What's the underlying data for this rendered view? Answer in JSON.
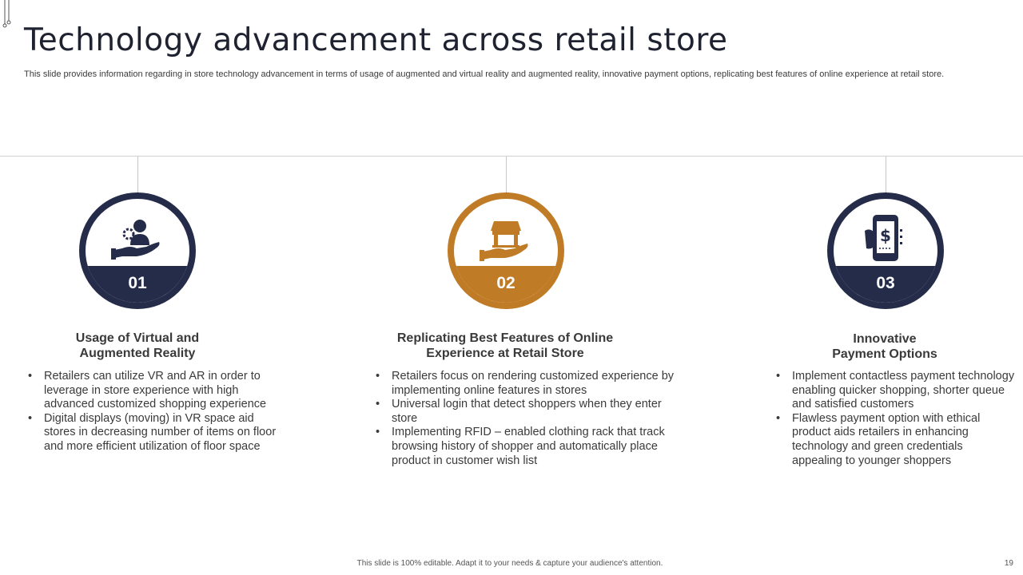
{
  "title": "Technology advancement across retail store",
  "subtitle": "This slide provides information regarding in store technology advancement in terms of usage of augmented and virtual reality and augmented reality, innovative payment options, replicating best features of online experience at retail store.",
  "colors": {
    "navy": "#252c4a",
    "gold": "#c07b26"
  },
  "columns": [
    {
      "number": "01",
      "icon": "person-in-hand-icon",
      "heading_line1": "Usage of Virtual and",
      "heading_line2": "Augmented Reality",
      "bullets": [
        "Retailers can utilize VR and AR in order to leverage in store experience with high advanced customized shopping experience",
        "Digital displays (moving) in VR space aid stores in decreasing number of items on floor and more efficient utilization of floor space"
      ]
    },
    {
      "number": "02",
      "icon": "store-in-hand-icon",
      "heading_line1": "Replicating Best Features of Online",
      "heading_line2": "Experience at Retail Store",
      "bullets": [
        "Retailers focus on rendering customized experience by implementing online features in stores",
        "Universal login that detect shoppers when they enter store",
        "Implementing RFID – enabled clothing rack that track browsing history of shopper and automatically place product in customer wish list"
      ]
    },
    {
      "number": "03",
      "icon": "mobile-payment-icon",
      "heading_line1": "Innovative",
      "heading_line2": "Payment Options",
      "bullets": [
        "Implement contactless payment technology enabling quicker shopping, shorter queue and satisfied customers",
        "Flawless payment option with ethical product aids retailers in enhancing technology and green credentials appealing to younger shoppers"
      ]
    }
  ],
  "footer": "This slide is 100% editable. Adapt it to your needs & capture your audience's attention.",
  "page_number": "19"
}
